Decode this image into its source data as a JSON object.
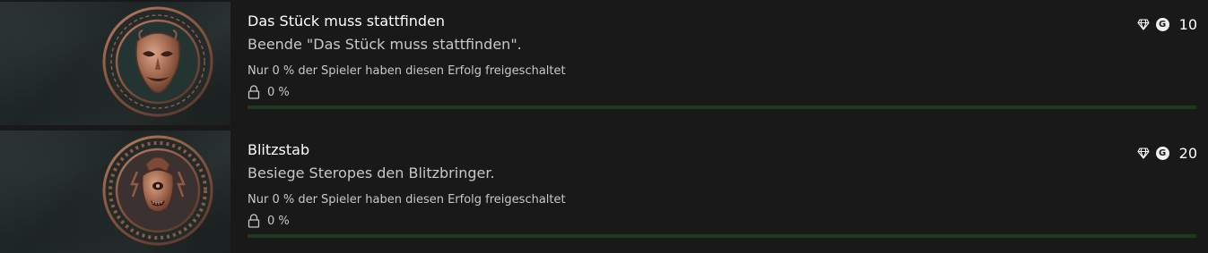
{
  "achievements": [
    {
      "title": "Das Stück muss stattfinden",
      "description": "Beende \"Das Stück muss stattfinden\".",
      "unlock_rate_text": "Nur 0 % der Spieler haben diesen Erfolg freigeschaltet",
      "progress_label": "0 %",
      "progress": 0,
      "gamerscore": "10",
      "badge_icon": "theater-mask-icon"
    },
    {
      "title": "Blitzstab",
      "description": "Besiege Steropes den Blitzbringer.",
      "unlock_rate_text": "Nur 0 % der Spieler haben diesen Erfolg freigeschaltet",
      "progress_label": "0 %",
      "progress": 0,
      "gamerscore": "20",
      "badge_icon": "cyclops-head-icon"
    }
  ],
  "icons": {
    "rarity": "diamond-icon",
    "gamerscore": "gamerscore-g-icon",
    "gamerscore_letter": "G",
    "lock": "lock-icon"
  },
  "colors": {
    "background": "#191919",
    "progress_track": "#1e3a1e",
    "text_primary": "#ffffff",
    "text_secondary": "#c8c8c8",
    "badge_bronze": "#b07a5e"
  }
}
